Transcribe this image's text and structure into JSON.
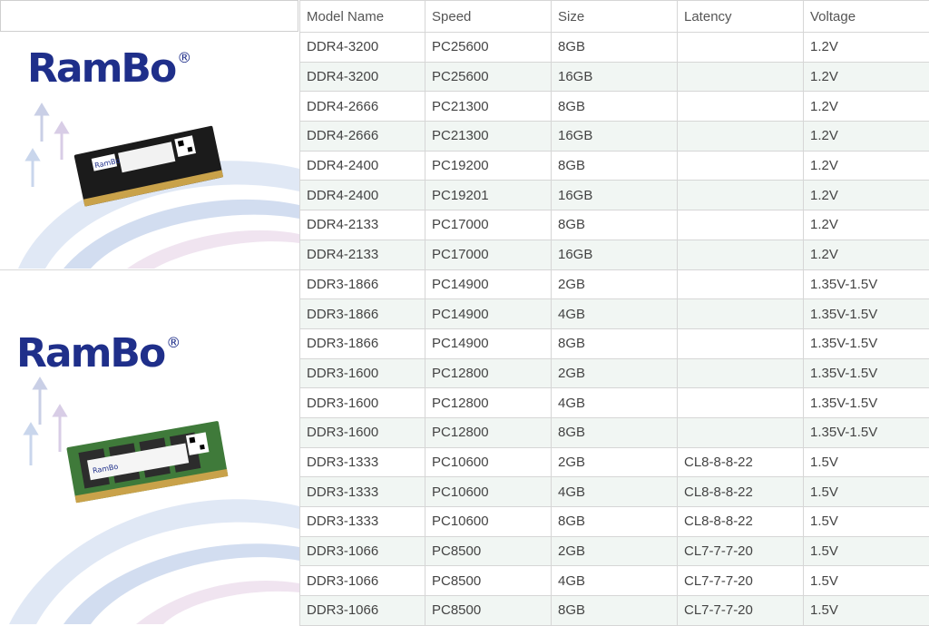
{
  "columns": [
    "Model Name",
    "Speed",
    "Size",
    "Latency",
    "Voltage"
  ],
  "brand": {
    "logo_text": "RamBo",
    "registered_mark": "®"
  },
  "rows": [
    [
      "DDR4-3200",
      "PC25600",
      "8GB",
      "",
      "1.2V"
    ],
    [
      "DDR4-3200",
      "PC25600",
      "16GB",
      "",
      "1.2V"
    ],
    [
      "DDR4-2666",
      "PC21300",
      "8GB",
      "",
      "1.2V"
    ],
    [
      "DDR4-2666",
      "PC21300",
      "16GB",
      "",
      "1.2V"
    ],
    [
      "DDR4-2400",
      "PC19200",
      "8GB",
      "",
      "1.2V"
    ],
    [
      "DDR4-2400",
      "PC19201",
      "16GB",
      "",
      "1.2V"
    ],
    [
      "DDR4-2133",
      "PC17000",
      "8GB",
      "",
      "1.2V"
    ],
    [
      "DDR4-2133",
      "PC17000",
      "16GB",
      "",
      "1.2V"
    ],
    [
      "DDR3-1866",
      "PC14900",
      "2GB",
      "",
      "1.35V-1.5V"
    ],
    [
      "DDR3-1866",
      "PC14900",
      "4GB",
      "",
      "1.35V-1.5V"
    ],
    [
      "DDR3-1866",
      "PC14900",
      "8GB",
      "",
      "1.35V-1.5V"
    ],
    [
      "DDR3-1600",
      "PC12800",
      "2GB",
      "",
      "1.35V-1.5V"
    ],
    [
      "DDR3-1600",
      "PC12800",
      "4GB",
      "",
      "1.35V-1.5V"
    ],
    [
      "DDR3-1600",
      "PC12800",
      "8GB",
      "",
      "1.35V-1.5V"
    ],
    [
      "DDR3-1333",
      "PC10600",
      "2GB",
      "CL8-8-8-22",
      "1.5V"
    ],
    [
      "DDR3-1333",
      "PC10600",
      "4GB",
      "CL8-8-8-22",
      "1.5V"
    ],
    [
      "DDR3-1333",
      "PC10600",
      "8GB",
      "CL8-8-8-22",
      "1.5V"
    ],
    [
      "DDR3-1066",
      "PC8500",
      "2GB",
      "CL7-7-7-20",
      "1.5V"
    ],
    [
      "DDR3-1066",
      "PC8500",
      "4GB",
      "CL7-7-7-20",
      "1.5V"
    ],
    [
      "DDR3-1066",
      "PC8500",
      "8GB",
      "CL7-7-7-20",
      "1.5V"
    ]
  ],
  "colors": {
    "brand_blue": "#1f2f8a",
    "ddr4_pcb": "#1b1b1b",
    "ddr3_pcb": "#3f7a3a",
    "gold_contacts": "#c9a24a",
    "row_stripe": "#f1f6f3"
  },
  "icons": [
    "swoosh-background",
    "qr-code-icon",
    "ram-module-image"
  ]
}
